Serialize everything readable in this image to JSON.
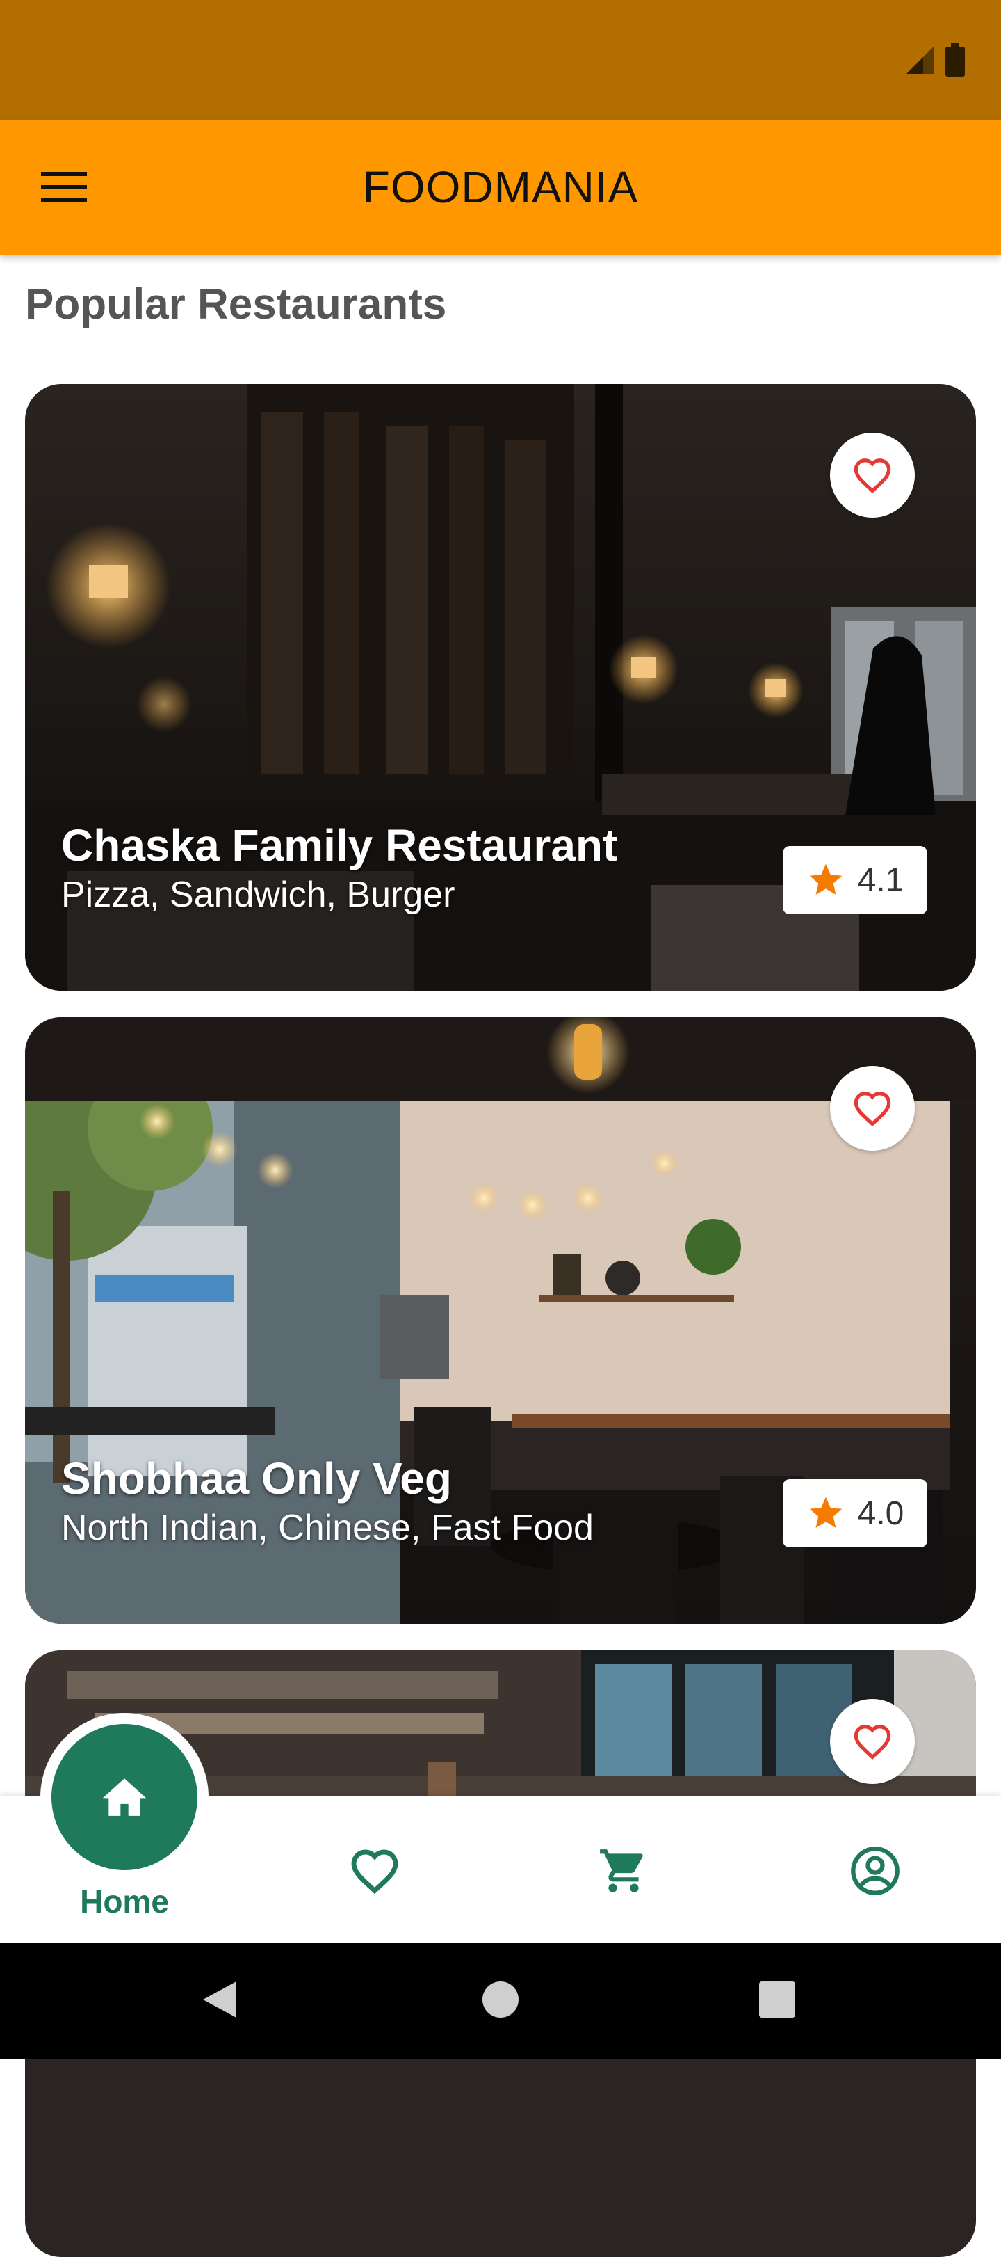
{
  "app": {
    "title": "FOODMANIA"
  },
  "section": {
    "title": "Popular Restaurants"
  },
  "restaurants": [
    {
      "name": "Chaska Family Restaurant",
      "cuisine": "Pizza, Sandwich, Burger",
      "rating": "4.1"
    },
    {
      "name": "Shobhaa Only Veg",
      "cuisine": "North Indian, Chinese, Fast Food",
      "rating": "4.0"
    }
  ],
  "bottom_nav": {
    "home_label": "Home",
    "items": [
      "home-icon",
      "heart-icon",
      "cart-icon",
      "profile-icon"
    ]
  },
  "colors": {
    "status_bar": "#B26F00",
    "app_bar": "#FF9800",
    "accent": "#1F7A5C",
    "star": "#F57C00",
    "heart": "#E53935"
  }
}
